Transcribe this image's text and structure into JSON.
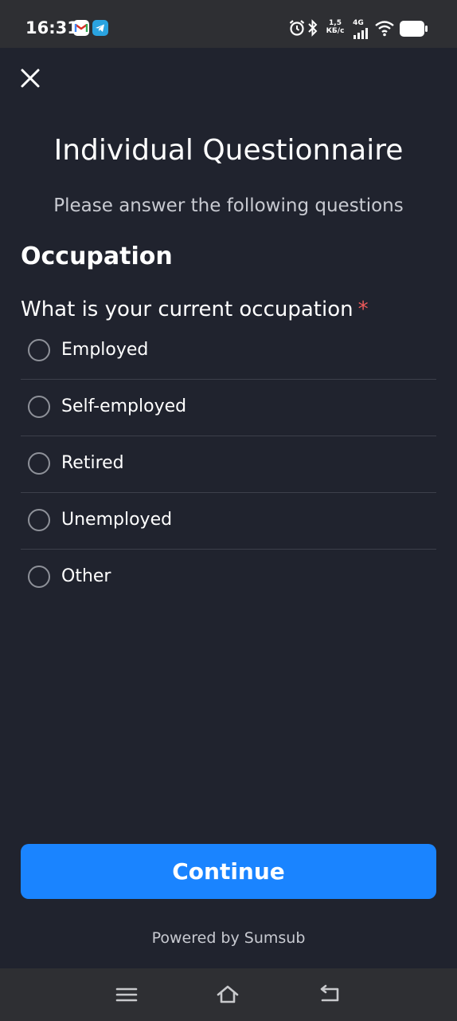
{
  "status_bar": {
    "time": "16:31",
    "notifications": [
      "gmail-icon",
      "telegram-icon"
    ],
    "net_speed_value": "1,5",
    "net_speed_unit": "КБ/с",
    "network_type": "4G",
    "icons": [
      "alarm-icon",
      "bluetooth-icon",
      "signal-icon",
      "wifi-icon",
      "battery-icon"
    ]
  },
  "header": {
    "close_icon": "close-icon",
    "title": "Individual Questionnaire",
    "subtitle": "Please answer the following questions"
  },
  "section": {
    "title": "Occupation",
    "question": "What is your current occupation",
    "required_marker": "*",
    "options": [
      {
        "label": "Employed",
        "selected": false
      },
      {
        "label": "Self-employed",
        "selected": false
      },
      {
        "label": "Retired",
        "selected": false
      },
      {
        "label": "Unemployed",
        "selected": false
      },
      {
        "label": "Other",
        "selected": false
      }
    ]
  },
  "footer": {
    "continue_label": "Continue",
    "powered_by": "Powered by Sumsub"
  },
  "nav_bar": {
    "icons": [
      "menu-icon",
      "home-icon",
      "back-icon"
    ]
  },
  "colors": {
    "background": "#20232e",
    "accent": "#1a84ff",
    "required": "#ee5a5a",
    "divider": "#3d404b"
  }
}
